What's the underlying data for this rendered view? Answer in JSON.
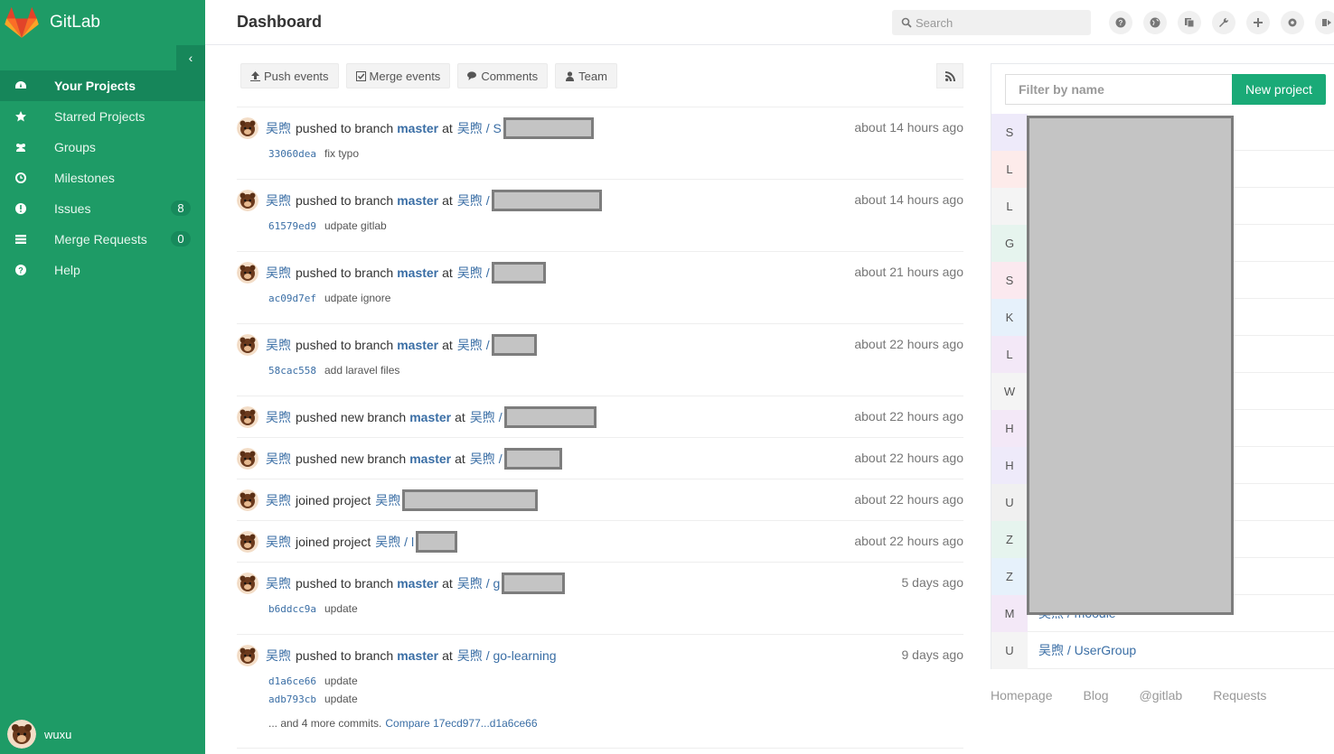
{
  "brand": {
    "name": "GitLab"
  },
  "sidebar": {
    "items": [
      {
        "label": "Your Projects",
        "icon": "dashboard-icon",
        "active": true
      },
      {
        "label": "Starred Projects",
        "icon": "star-icon"
      },
      {
        "label": "Groups",
        "icon": "group-icon"
      },
      {
        "label": "Milestones",
        "icon": "clock-icon"
      },
      {
        "label": "Issues",
        "icon": "exclamation-icon",
        "badge": "8"
      },
      {
        "label": "Merge Requests",
        "icon": "list-icon",
        "badge": "0"
      },
      {
        "label": "Help",
        "icon": "question-icon"
      }
    ],
    "user": "wuxu"
  },
  "header": {
    "title": "Dashboard",
    "search_placeholder": "Search"
  },
  "filters": {
    "push": "Push events",
    "merge": "Merge events",
    "comments": "Comments",
    "team": "Team"
  },
  "events": [
    {
      "author": "吴煦",
      "action": "pushed to branch",
      "branch": "master",
      "at": "at",
      "project": "吴煦 / S",
      "time": "about 14 hours ago",
      "commits": [
        {
          "sha": "33060dea",
          "msg": "fix typo"
        }
      ]
    },
    {
      "author": "吴煦",
      "action": "pushed to branch",
      "branch": "master",
      "at": "at",
      "project": "吴煦 /",
      "time": "about 14 hours ago",
      "commits": [
        {
          "sha": "61579ed9",
          "msg": "udpate gitlab"
        }
      ]
    },
    {
      "author": "吴煦",
      "action": "pushed to branch",
      "branch": "master",
      "at": "at",
      "project": "吴煦 /",
      "time": "about 21 hours ago",
      "commits": [
        {
          "sha": "ac09d7ef",
          "msg": "udpate ignore"
        }
      ]
    },
    {
      "author": "吴煦",
      "action": "pushed to branch",
      "branch": "master",
      "at": "at",
      "project": "吴煦 /",
      "time": "about 22 hours ago",
      "commits": [
        {
          "sha": "58cac558",
          "msg": "add laravel files"
        }
      ]
    },
    {
      "author": "吴煦",
      "action": "pushed new branch",
      "branch": "master",
      "at": "at",
      "project": "吴煦 /",
      "time": "about 22 hours ago",
      "commits": []
    },
    {
      "author": "吴煦",
      "action": "pushed new branch",
      "branch": "master",
      "at": "at",
      "project": "吴煦 /",
      "time": "about 22 hours ago",
      "commits": []
    },
    {
      "author": "吴煦",
      "action": "joined project",
      "branch": "",
      "at": "",
      "project": "吴煦",
      "time": "about 22 hours ago",
      "commits": []
    },
    {
      "author": "吴煦",
      "action": "joined project",
      "branch": "",
      "at": "",
      "project": "吴煦 / l",
      "time": "about 22 hours ago",
      "commits": []
    },
    {
      "author": "吴煦",
      "action": "pushed to branch",
      "branch": "master",
      "at": "at",
      "project": "吴煦 / g",
      "time": "5 days ago",
      "commits": [
        {
          "sha": "b6ddcc9a",
          "msg": "update"
        }
      ]
    },
    {
      "author": "吴煦",
      "action": "pushed to branch",
      "branch": "master",
      "at": "at",
      "project": "吴煦 / go-learning",
      "time": "9 days ago",
      "commits": [
        {
          "sha": "d1a6ce66",
          "msg": "update"
        },
        {
          "sha": "adb793cb",
          "msg": "update"
        }
      ],
      "more": "... and 4 more commits.",
      "compare": "Compare 17ecd977...d1a6ce66"
    }
  ],
  "projects_panel": {
    "filter_placeholder": "Filter by name",
    "new_project": "New project",
    "rows": [
      {
        "letter": "S",
        "bg": "#eeeafa",
        "name": ""
      },
      {
        "letter": "L",
        "bg": "#fdebea",
        "name": ""
      },
      {
        "letter": "L",
        "bg": "#f4f4f4",
        "name": ""
      },
      {
        "letter": "G",
        "bg": "#e6f4ee",
        "name": ""
      },
      {
        "letter": "S",
        "bg": "#fbe9ef",
        "name": ""
      },
      {
        "letter": "K",
        "bg": "#e6f1fb",
        "name": ""
      },
      {
        "letter": "L",
        "bg": "#f3e8f7",
        "name": ""
      },
      {
        "letter": "W",
        "bg": "#f4f4f4",
        "name": ""
      },
      {
        "letter": "H",
        "bg": "#f3e8f7",
        "name": ""
      },
      {
        "letter": "H",
        "bg": "#eeeafa",
        "name": ""
      },
      {
        "letter": "U",
        "bg": "#f0f0f0",
        "name": ""
      },
      {
        "letter": "Z",
        "bg": "#e6f4ee",
        "name": ""
      },
      {
        "letter": "Z",
        "bg": "#e6f1fb",
        "name": ""
      },
      {
        "letter": "M",
        "bg": "#f3e8f7",
        "name": "吴煦 / moodle"
      },
      {
        "letter": "U",
        "bg": "#f4f4f4",
        "name": "吴煦 / UserGroup"
      }
    ]
  },
  "footer": {
    "links": [
      "Homepage",
      "Blog",
      "@gitlab",
      "Requests"
    ]
  }
}
